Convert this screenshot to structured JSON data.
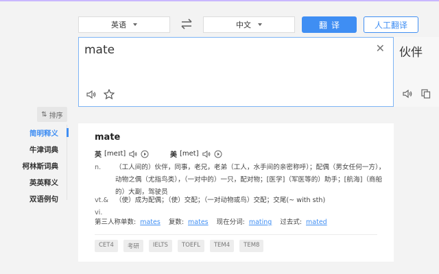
{
  "header": {
    "source_lang": "英语",
    "target_lang": "中文",
    "translate_button": "翻译",
    "human_translate_button": "人工翻译"
  },
  "input": {
    "text": "mate"
  },
  "result": {
    "text": "伙伴"
  },
  "sidebar": {
    "sort_label": "排序",
    "items": [
      {
        "label": "简明释义",
        "active": true
      },
      {
        "label": "牛津词典",
        "active": false
      },
      {
        "label": "柯林斯词典",
        "active": false
      },
      {
        "label": "英英释义",
        "active": false
      },
      {
        "label": "双语例句",
        "active": false
      }
    ]
  },
  "entry": {
    "word": "mate",
    "phonetics": [
      {
        "label": "英",
        "ipa": "[meɪt]"
      },
      {
        "label": "美",
        "ipa": "[met]"
      }
    ],
    "definitions": [
      {
        "pos": "n.",
        "text": "（工人间的）伙伴，同事，老兄，老弟（工人，水手间的亲密称呼）；配偶（男女任何一方），动物之偶（尤指鸟类），（一对中的）一只，配对物；[医学]（军医等的）助手；[航海]（商船的）大副，驾驶员"
      },
      {
        "pos": "vt.& vi.",
        "text": "（使）成为配偶；（使）交配；（一对动物或鸟）交配；交尾(~ with sth)"
      }
    ],
    "forms": [
      {
        "label": "第三人称单数:",
        "value": "mates"
      },
      {
        "label": "复数:",
        "value": "mates"
      },
      {
        "label": "现在分词:",
        "value": "mating"
      },
      {
        "label": "过去式:",
        "value": "mated"
      }
    ],
    "tags": [
      "CET4",
      "考研",
      "IELTS",
      "TOEFL",
      "TEM4",
      "TEM8"
    ]
  },
  "colors": {
    "accent": "#3f8ef3",
    "background": "#f3f3f3"
  }
}
